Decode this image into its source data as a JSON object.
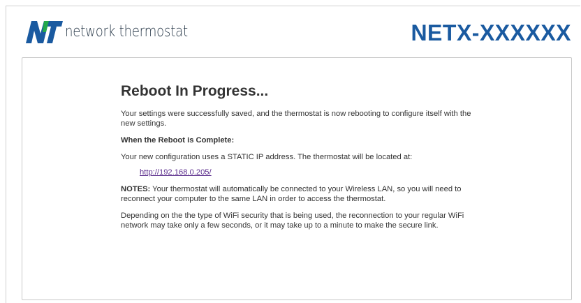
{
  "header": {
    "logo_text": "network thermostat",
    "device_name": "NETX-XXXXXX",
    "colors": {
      "logo_blue": "#1a5aa0",
      "logo_green": "#22a84a",
      "device_name": "#1a5aa0"
    }
  },
  "main": {
    "title": "Reboot In Progress...",
    "intro": "Your settings were successfully saved, and the thermostat is now rebooting to configure itself with the new settings.",
    "subheading": "When the Reboot is Complete:",
    "config_text": "Your new configuration uses a STATIC IP address. The thermostat will be located at:",
    "address_link": "http://192.168.0.205/",
    "notes_label": "NOTES:",
    "notes_text": " Your thermostat will automatically be connected to your Wireless LAN, so you will need to reconnect your computer to the same LAN in order to access the thermostat.",
    "wifi_text": "Depending on the the type of WiFi security that is being used, the reconnection to your regular WiFi network may take only a few seconds, or it may take up to a minute to make the secure link."
  }
}
